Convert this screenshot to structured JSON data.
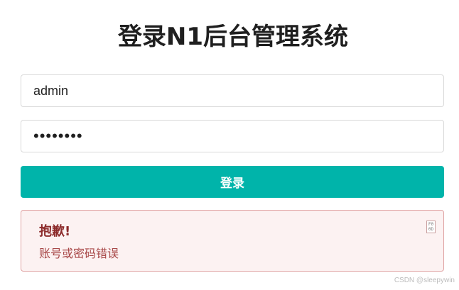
{
  "page": {
    "title": "登录N1后台管理系统"
  },
  "form": {
    "username_value": "admin",
    "password_value": "password",
    "login_label": "登录"
  },
  "alert": {
    "title": "抱歉!",
    "message": "账号或密码错误",
    "close_glyph": "F 0 0 D"
  },
  "watermark": "CSDN @sleepywin",
  "colors": {
    "accent": "#00b4aa",
    "alert_bg": "#fcf2f2",
    "alert_border": "#e0a3a3",
    "alert_title": "#8c2b2b",
    "alert_text": "#a84848"
  }
}
